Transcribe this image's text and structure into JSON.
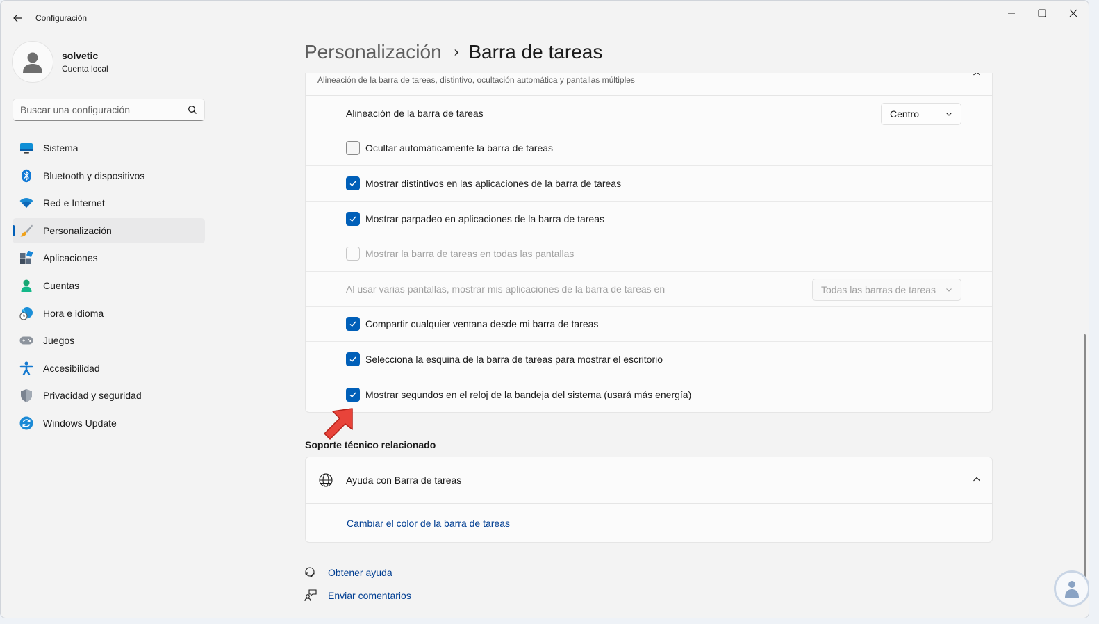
{
  "window": {
    "title": "Configuración",
    "accent": "#005fb8"
  },
  "profile": {
    "name": "solvetic",
    "account_type": "Cuenta local"
  },
  "search": {
    "placeholder": "Buscar una configuración",
    "value": ""
  },
  "sidebar": {
    "items": [
      {
        "label": "Sistema",
        "icon": "monitor-icon",
        "active": false
      },
      {
        "label": "Bluetooth y dispositivos",
        "icon": "bluetooth-icon",
        "active": false
      },
      {
        "label": "Red e Internet",
        "icon": "wifi-icon",
        "active": false
      },
      {
        "label": "Personalización",
        "icon": "paintbrush-icon",
        "active": true
      },
      {
        "label": "Aplicaciones",
        "icon": "apps-icon",
        "active": false
      },
      {
        "label": "Cuentas",
        "icon": "person-icon",
        "active": false
      },
      {
        "label": "Hora e idioma",
        "icon": "globe-clock-icon",
        "active": false
      },
      {
        "label": "Juegos",
        "icon": "gamepad-icon",
        "active": false
      },
      {
        "label": "Accesibilidad",
        "icon": "accessibility-icon",
        "active": false
      },
      {
        "label": "Privacidad y seguridad",
        "icon": "shield-icon",
        "active": false
      },
      {
        "label": "Windows Update",
        "icon": "update-icon",
        "active": false
      }
    ]
  },
  "breadcrumb": {
    "parent": "Personalización",
    "separator": "›",
    "current": "Barra de tareas"
  },
  "behaviors_card": {
    "description": "Alineación de la barra de tareas, distintivo, ocultación automática y pantallas múltiples",
    "alignment_label": "Alineación de la barra de tareas",
    "alignment_value": "Centro",
    "options": [
      {
        "label": "Ocultar automáticamente la barra de tareas",
        "checked": false,
        "disabled": false
      },
      {
        "label": "Mostrar distintivos en las aplicaciones de la barra de tareas",
        "checked": true,
        "disabled": false
      },
      {
        "label": "Mostrar parpadeo en aplicaciones de la barra de tareas",
        "checked": true,
        "disabled": false
      },
      {
        "label": "Mostrar la barra de tareas en todas las pantallas",
        "checked": false,
        "disabled": true
      }
    ],
    "multi_display_label": "Al usar varias pantallas, mostrar mis aplicaciones de la barra de tareas en",
    "multi_display_value": "Todas las barras de tareas",
    "options2": [
      {
        "label": "Compartir cualquier ventana desde mi barra de tareas",
        "checked": true,
        "disabled": false
      },
      {
        "label": "Selecciona la esquina de la barra de tareas para mostrar el escritorio",
        "checked": true,
        "disabled": false
      },
      {
        "label": "Mostrar segundos en el reloj de la bandeja del sistema (usará más energía)",
        "checked": true,
        "disabled": false
      }
    ]
  },
  "related_support": {
    "section_title": "Soporte técnico relacionado",
    "help_title": "Ayuda con Barra de tareas",
    "link": "Cambiar el color de la barra de tareas"
  },
  "footer": {
    "get_help": "Obtener ayuda",
    "feedback": "Enviar comentarios"
  }
}
